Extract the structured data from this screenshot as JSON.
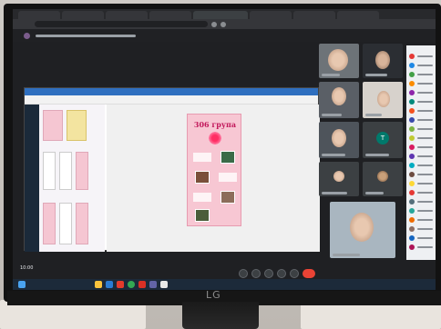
{
  "browser": {
    "tabs": [
      "",
      "",
      "",
      "",
      "",
      "",
      "",
      ""
    ],
    "address": ""
  },
  "meeting": {
    "organizer_line": "",
    "time": "10:00",
    "code": ""
  },
  "shared_screen": {
    "poster_title": "306 група"
  },
  "participants": {
    "tiles": [
      {
        "name": "",
        "type": "video"
      },
      {
        "name": "",
        "type": "video"
      },
      {
        "name": "",
        "type": "video"
      },
      {
        "name": "",
        "type": "video"
      },
      {
        "name": "",
        "type": "video"
      },
      {
        "name": "",
        "type": "initial",
        "initial": "T",
        "color": "#00796b"
      },
      {
        "name": "",
        "type": "photo"
      },
      {
        "name": "",
        "type": "photo"
      },
      {
        "name": "",
        "type": "video"
      }
    ],
    "sidebar_colors": [
      "#e53935",
      "#1e88e5",
      "#43a047",
      "#fb8c00",
      "#8e24aa",
      "#00897b",
      "#f4511e",
      "#3949ab",
      "#7cb342",
      "#c0ca33",
      "#d81b60",
      "#5e35b1",
      "#00acc1",
      "#6d4c41",
      "#fdd835",
      "#e53935",
      "#546e7a",
      "#26a69a",
      "#ef6c00",
      "#8d6e63",
      "#1565c0",
      "#ad1457"
    ]
  },
  "controls": {
    "end_call_color": "#ea4335"
  },
  "monitor": {
    "brand": "LG"
  },
  "icons": [
    "camera-icon",
    "mic-icon",
    "present-icon",
    "more-icon",
    "end-call-icon",
    "windows-start-icon"
  ]
}
